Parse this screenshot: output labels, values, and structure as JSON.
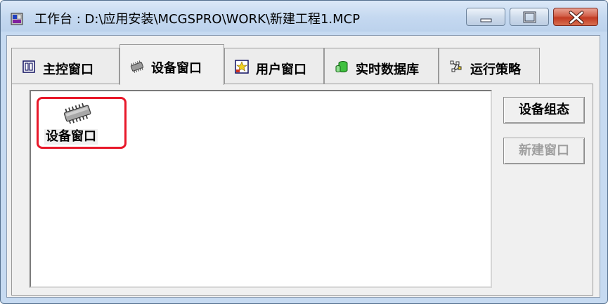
{
  "window": {
    "title": "工作台 : D:\\应用安装\\MCGSPRO\\WORK\\新建工程1.MCP",
    "controls": {
      "minimize": "minimize-icon",
      "maximize": "maximize-icon",
      "close": "close-icon"
    }
  },
  "tabs": [
    {
      "label": "主控窗口",
      "icon": "main-window-icon"
    },
    {
      "label": "设备窗口",
      "icon": "device-chip-icon",
      "active": true
    },
    {
      "label": "用户窗口",
      "icon": "user-window-icon"
    },
    {
      "label": "实时数据库",
      "icon": "database-icon"
    },
    {
      "label": "运行策略",
      "icon": "strategy-icon"
    }
  ],
  "content": {
    "items": [
      {
        "label": "设备窗口",
        "icon": "device-chip-icon",
        "highlighted": true
      }
    ]
  },
  "buttons": {
    "configure": "设备组态",
    "new_window": "新建窗口"
  },
  "colors": {
    "highlight": "#e8182a",
    "close_button": "#c23a22",
    "disabled_text": "#a0a0a0"
  }
}
